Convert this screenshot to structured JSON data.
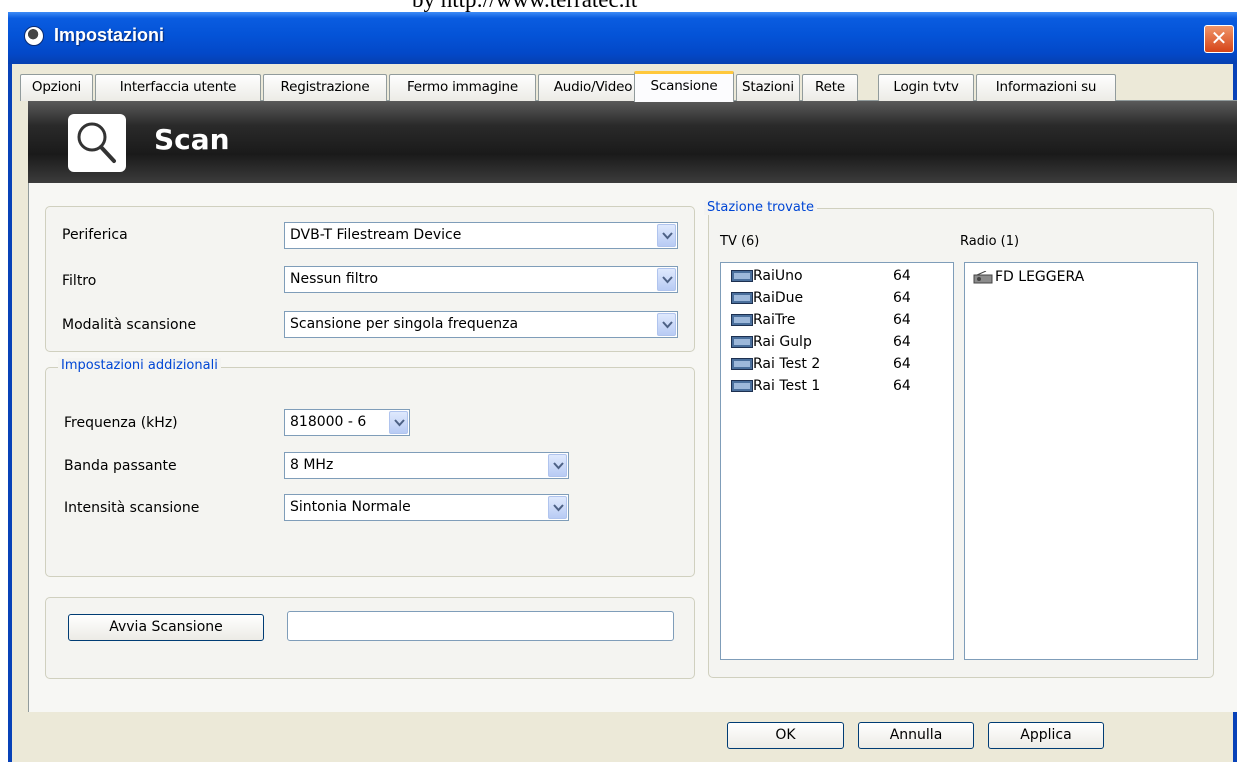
{
  "watermark": "by  http://www.terratec.it",
  "window": {
    "title": "Impostazioni",
    "close_symbol": "✕"
  },
  "tabs": [
    {
      "label": "Opzioni"
    },
    {
      "label": "Interfaccia utente"
    },
    {
      "label": "Registrazione"
    },
    {
      "label": "Fermo immagine"
    },
    {
      "label": "Audio/Video"
    },
    {
      "label": "Scansione",
      "active": true
    },
    {
      "label": "Stazioni"
    },
    {
      "label": "Rete"
    },
    {
      "label": "Login tvtv"
    },
    {
      "label": "Informazioni su"
    }
  ],
  "banner": {
    "title": "Scan",
    "icon": "magnifier-icon"
  },
  "main_settings": {
    "periferica": {
      "label": "Periferica",
      "value": "DVB-T Filestream Device"
    },
    "filtro": {
      "label": "Filtro",
      "value": "Nessun filtro"
    },
    "modalita": {
      "label": "Modalità scansione",
      "value": "Scansione per singola frequenza"
    }
  },
  "additional": {
    "legend": "Impostazioni addizionali",
    "frequenza": {
      "label": "Frequenza (kHz)",
      "value": "818000 - 6"
    },
    "banda": {
      "label": "Banda passante",
      "value": "8 MHz"
    },
    "intensita": {
      "label": "Intensità scansione",
      "value": "Sintonia Normale"
    }
  },
  "scan": {
    "button": "Avvia Scansione",
    "progress_value": ""
  },
  "stations": {
    "legend": "Stazione trovate",
    "tv_header": "TV (6)",
    "radio_header": "Radio (1)",
    "tv": [
      {
        "name": "RaiUno",
        "num": "64"
      },
      {
        "name": "RaiDue",
        "num": "64"
      },
      {
        "name": "RaiTre",
        "num": "64"
      },
      {
        "name": "Rai Gulp",
        "num": "64"
      },
      {
        "name": "Rai Test 2",
        "num": "64"
      },
      {
        "name": "Rai Test 1",
        "num": "64"
      }
    ],
    "radio": [
      {
        "name": "FD LEGGERA"
      }
    ]
  },
  "footer": {
    "ok": "OK",
    "cancel": "Annulla",
    "apply": "Applica"
  },
  "colors": {
    "titlebar": "#0453d7",
    "legend_text": "#0046d5",
    "active_tab_accent": "#ffc83c"
  }
}
